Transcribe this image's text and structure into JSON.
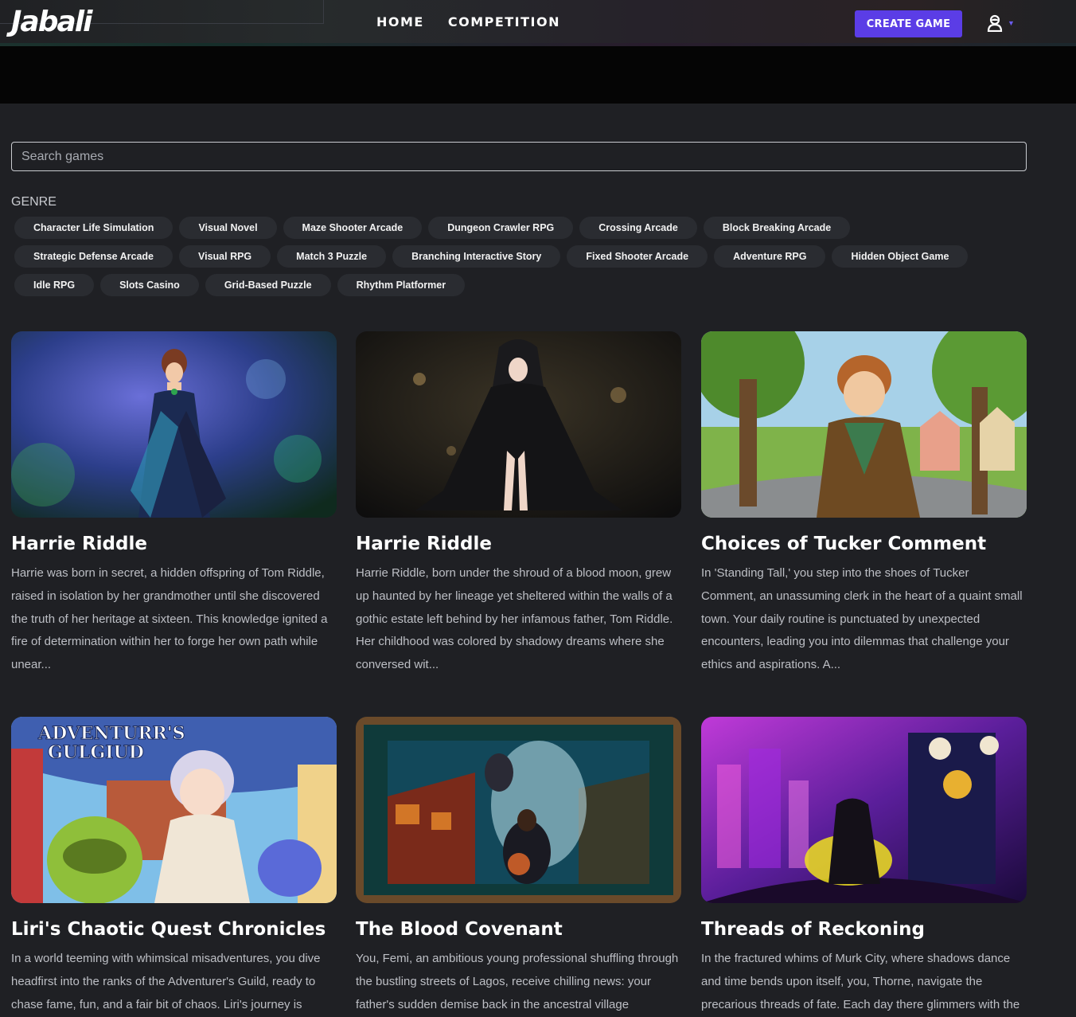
{
  "header": {
    "logo": "Jabali",
    "nav": [
      {
        "label": "HOME"
      },
      {
        "label": "COMPETITION"
      }
    ],
    "create_button": "CREATE GAME",
    "user_icon": "user-icon",
    "accent": "#5b3de6"
  },
  "search": {
    "placeholder": "Search games",
    "value": ""
  },
  "genre": {
    "label": "GENRE",
    "chips": [
      "Character Life Simulation",
      "Visual Novel",
      "Maze Shooter Arcade",
      "Dungeon Crawler RPG",
      "Crossing Arcade",
      "Block Breaking Arcade",
      "Strategic Defense Arcade",
      "Visual RPG",
      "Match 3 Puzzle",
      "Branching Interactive Story",
      "Fixed Shooter Arcade",
      "Adventure RPG",
      "Hidden Object Game",
      "Idle RPG",
      "Slots Casino",
      "Grid-Based Puzzle",
      "Rhythm Platformer"
    ]
  },
  "games": [
    {
      "title": "Harrie Riddle",
      "description": "Harrie was born in secret, a hidden offspring of Tom Riddle, raised in isolation by her grandmother until she discovered the truth of her heritage at sixteen. This knowledge ignited a fire of determination within her to forge her own path while unear..."
    },
    {
      "title": "Harrie Riddle",
      "description": "Harrie Riddle, born under the shroud of a blood moon, grew up haunted by her lineage yet sheltered within the walls of a gothic estate left behind by her infamous father, Tom Riddle. Her childhood was colored by shadowy dreams where she conversed wit..."
    },
    {
      "title": "Choices of Tucker Comment",
      "description": "In 'Standing Tall,' you step into the shoes of Tucker Comment, an unassuming clerk in the heart of a quaint small town. Your daily routine is punctuated by unexpected encounters, leading you into dilemmas that challenge your ethics and aspirations. A..."
    },
    {
      "title": "Liri's Chaotic Quest Chronicles",
      "description": "In a world teeming with whimsical misadventures, you dive headfirst into the ranks of the Adventurer's Guild, ready to chase fame, fun, and a fair bit of chaos. Liri's journey is",
      "image_text": [
        "ADVENTURR'S",
        "GULGIUD"
      ]
    },
    {
      "title": "The Blood Covenant",
      "description": "You, Femi, an ambitious young professional shuffling through the bustling streets of Lagos, receive chilling news: your father's sudden demise back in the ancestral village"
    },
    {
      "title": "Threads of Reckoning",
      "description": "In the fractured whims of Murk City, where shadows dance and time bends upon itself, you, Thorne, navigate the precarious threads of fate. Each day there glimmers with the"
    }
  ]
}
